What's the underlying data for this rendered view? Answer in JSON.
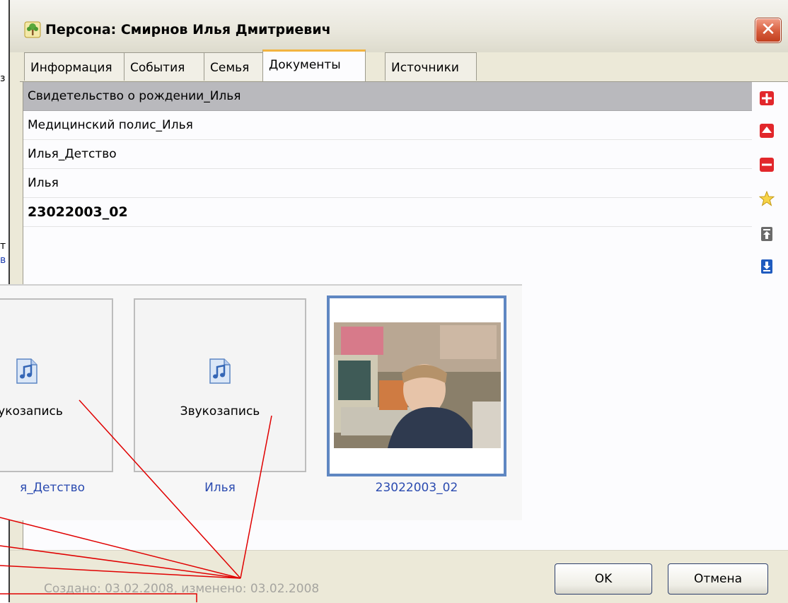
{
  "window": {
    "title": "Персона: Смирнов Илья Дмитриевич",
    "close_glyph": "✕"
  },
  "tabs": [
    {
      "label": "Информация"
    },
    {
      "label": "События"
    },
    {
      "label": "Семья"
    },
    {
      "label": "Документы",
      "active": true
    },
    {
      "label": "Источники"
    }
  ],
  "documents": [
    {
      "name": "Свидетельство о рождении_Илья",
      "selected": true
    },
    {
      "name": "Медицинский полис_Илья"
    },
    {
      "name": "Илья_Детство"
    },
    {
      "name": "Илья"
    },
    {
      "name": "23022003_02",
      "bold": true
    }
  ],
  "toolbar": {
    "icons": [
      "add-icon",
      "move-up-icon",
      "remove-icon",
      "favorite-star-icon",
      "move-top-icon",
      "move-bottom-icon"
    ]
  },
  "thumbnails": [
    {
      "label": "вукозапись",
      "caption": "я_Детство",
      "icon": "audio-file-icon"
    },
    {
      "label": "Звукозапись",
      "caption": "Илья",
      "icon": "audio-file-icon"
    },
    {
      "label": "",
      "caption": "23022003_02",
      "icon": "photo",
      "selected": true
    }
  ],
  "status": {
    "text": "Создано: 03.02.2008, изменено: 03.02.2008"
  },
  "buttons": {
    "ok": "OK",
    "cancel": "Отмена"
  },
  "under_window": {
    "glyphs": [
      "з",
      "т",
      "в"
    ]
  },
  "colors": {
    "annotation": "#e00000",
    "selection_border": "#5f87c2",
    "link": "#2b4bb0"
  }
}
